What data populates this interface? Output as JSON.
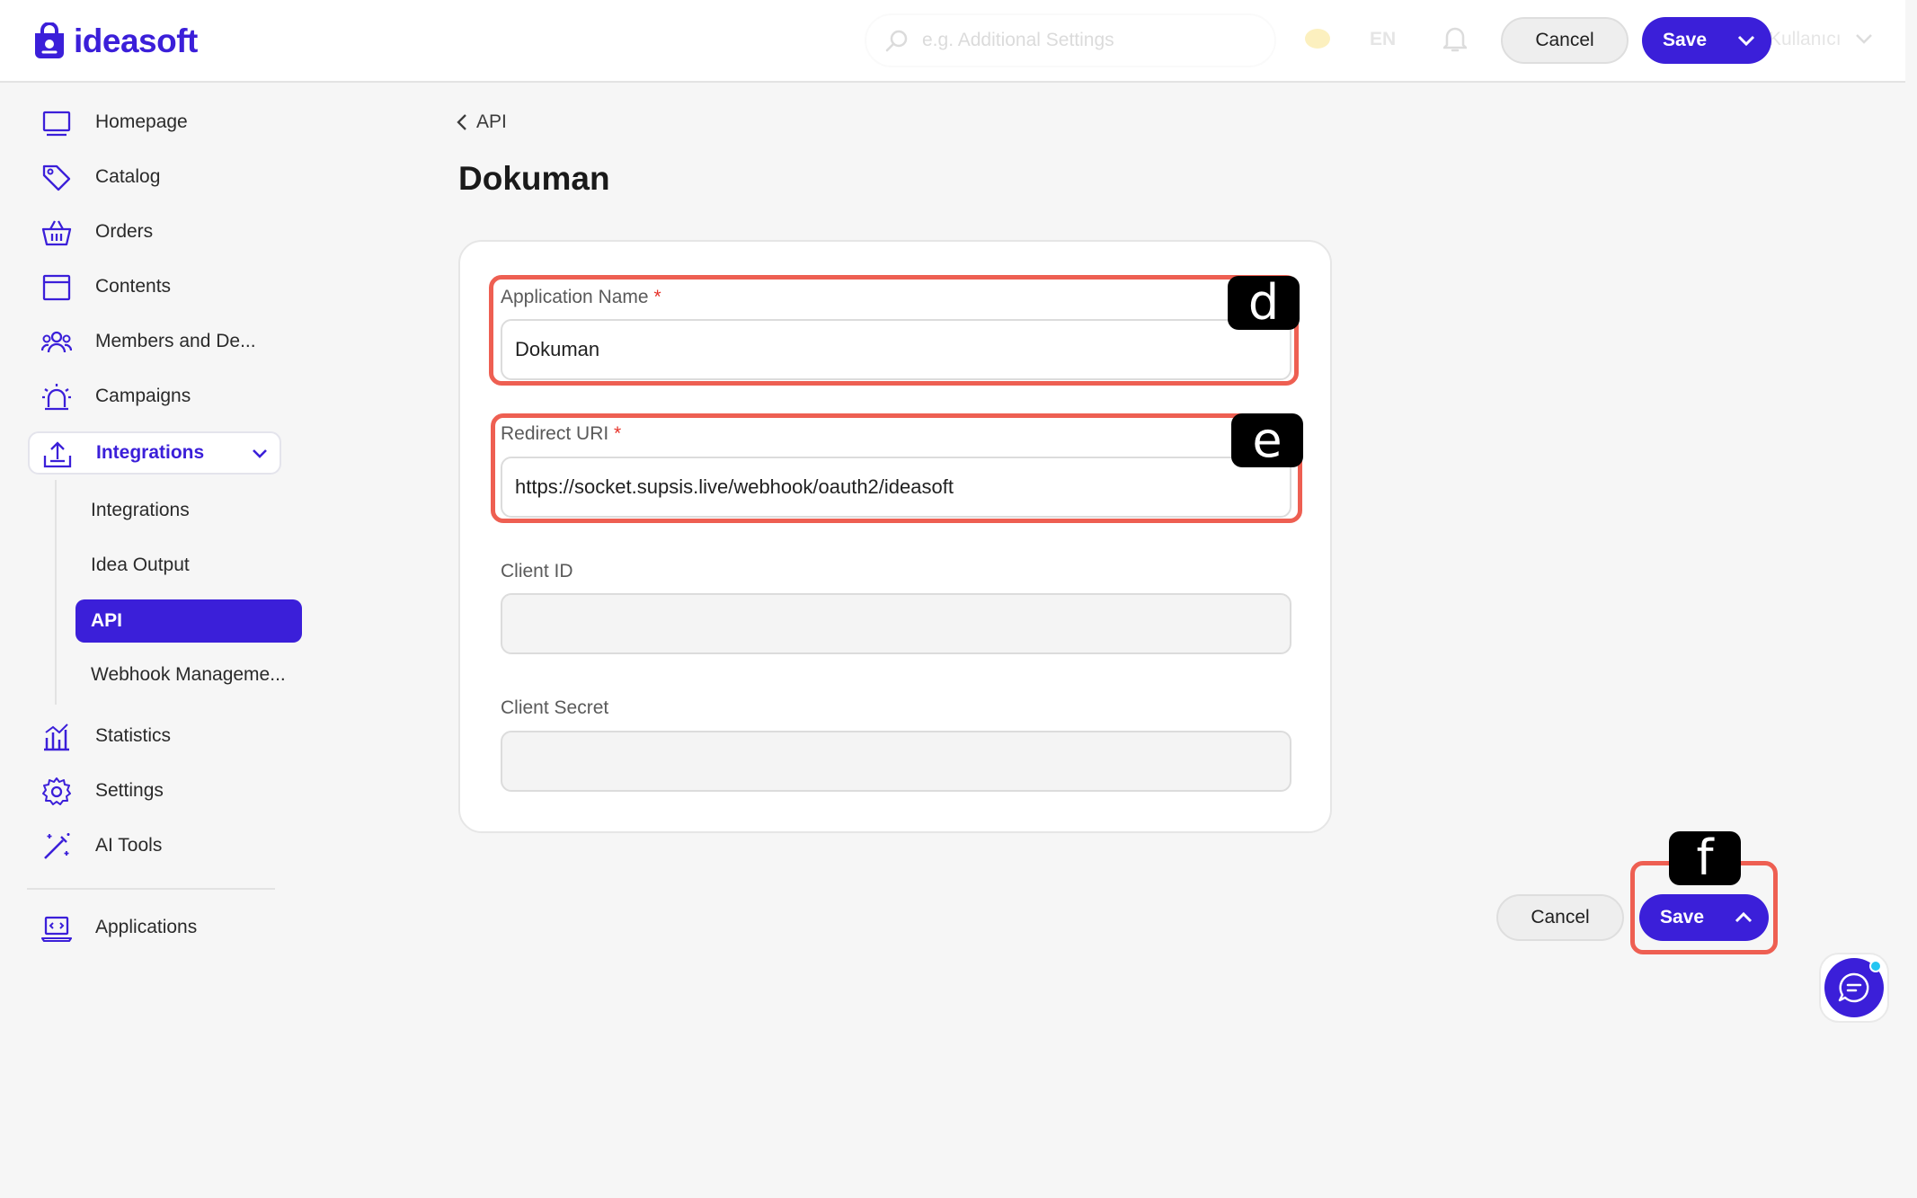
{
  "brand": {
    "name": "ideasoft"
  },
  "header": {
    "search_placeholder": "e.g. Additional Settings",
    "language": "EN",
    "user_label": "Kullanıcı",
    "cancel_label": "Cancel",
    "save_label": "Save"
  },
  "sidebar": {
    "items": [
      {
        "label": "Homepage",
        "icon": "monitor-icon"
      },
      {
        "label": "Catalog",
        "icon": "tag-icon"
      },
      {
        "label": "Orders",
        "icon": "basket-icon"
      },
      {
        "label": "Contents",
        "icon": "browser-window-icon"
      },
      {
        "label": "Members and De...",
        "icon": "users-icon"
      },
      {
        "label": "Campaigns",
        "icon": "alarm-light-icon"
      },
      {
        "label": "Integrations",
        "icon": "upload-box-icon"
      },
      {
        "label": "Statistics",
        "icon": "bar-chart-icon"
      },
      {
        "label": "Settings",
        "icon": "gear-icon"
      },
      {
        "label": "AI Tools",
        "icon": "magic-wand-icon"
      },
      {
        "label": "Applications",
        "icon": "laptop-code-icon"
      }
    ],
    "sub_items": [
      {
        "label": "Integrations"
      },
      {
        "label": "Idea Output"
      },
      {
        "label": "API"
      },
      {
        "label": "Webhook Manageme..."
      }
    ]
  },
  "main": {
    "breadcrumb": "API",
    "title": "Dokuman",
    "fields": {
      "app_name": {
        "label": "Application Name",
        "required": "*",
        "value": "Dokuman"
      },
      "redirect_uri": {
        "label": "Redirect URI",
        "required": "*",
        "value": "https://socket.supsis.live/webhook/oauth2/ideasoft"
      },
      "client_id": {
        "label": "Client ID",
        "value": ""
      },
      "client_secret": {
        "label": "Client Secret",
        "value": ""
      }
    },
    "cancel_label": "Cancel",
    "save_label": "Save"
  },
  "annotations": {
    "d": "d",
    "e": "e",
    "f": "f"
  },
  "colors": {
    "accent": "#3b1fd9",
    "highlight": "#ee5f52",
    "required": "#e6332a"
  }
}
